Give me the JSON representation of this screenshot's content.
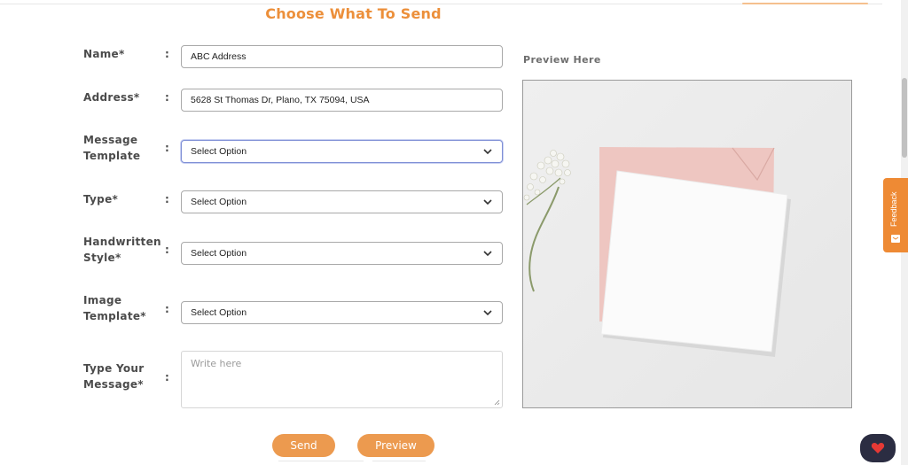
{
  "heading": "Choose What To Send",
  "form": {
    "name": {
      "label": "Name*",
      "value": "ABC Address"
    },
    "address": {
      "label": "Address*",
      "value": "5628 St Thomas Dr, Plano, TX 75094, USA"
    },
    "message_template": {
      "label": "Message Template",
      "value": "Select Option"
    },
    "type": {
      "label": "Type*",
      "value": "Select Option"
    },
    "handwritten_style": {
      "label": "Handwritten Style*",
      "value": "Select Option"
    },
    "image_template": {
      "label": "Image Template*",
      "value": "Select Option"
    },
    "message": {
      "label": "Type Your Message*",
      "placeholder": "Write here"
    },
    "colon": ":"
  },
  "preview": {
    "title": "Preview Here"
  },
  "buttons": {
    "send": "Send",
    "preview": "Preview"
  },
  "feedback": {
    "label": "Feedback"
  },
  "colors": {
    "accent": "#ec8f3a",
    "button": "#ec9a4f",
    "heart": "#e53935"
  },
  "icons": [
    "chevron-down-icon",
    "heart-icon",
    "feedback-icon",
    "resize-handle-icon"
  ]
}
